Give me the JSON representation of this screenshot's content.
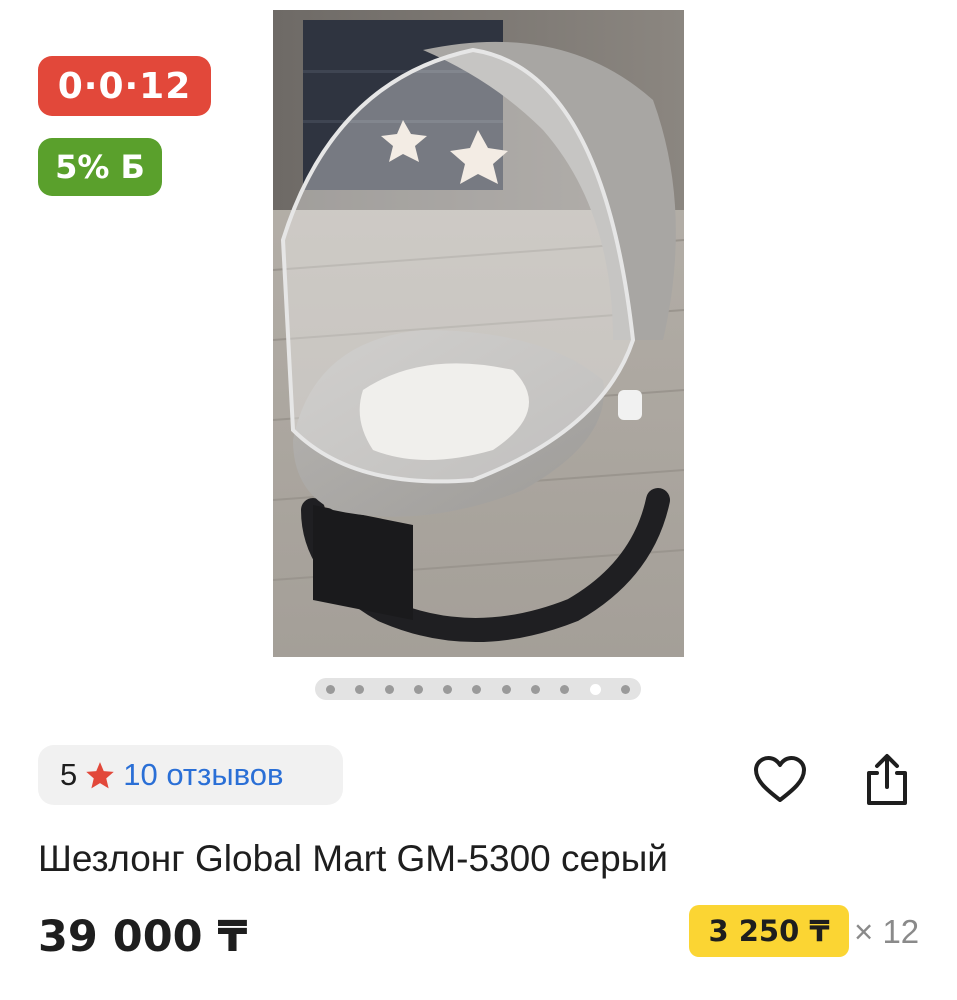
{
  "badges": {
    "installment": "0·0·12",
    "bonus": "5% Б"
  },
  "gallery": {
    "total_images": 11,
    "active_index": 9
  },
  "rating": {
    "value": "5",
    "reviews": "10 отзывов",
    "star_color": "#e2483a"
  },
  "product": {
    "title": "Шезлонг Global Mart GM-5300 серый",
    "price": "39 000 ₸",
    "monthly_payment": "3 250 ₸",
    "months": "× 12"
  },
  "icons": {
    "favorite": "heart-outline-icon",
    "share": "share-icon",
    "rating_star": "star-icon"
  },
  "colors": {
    "installment_badge": "#e2483a",
    "bonus_badge": "#5aa02c",
    "monthly_badge": "#fbd533",
    "link": "#2a6fd6"
  }
}
